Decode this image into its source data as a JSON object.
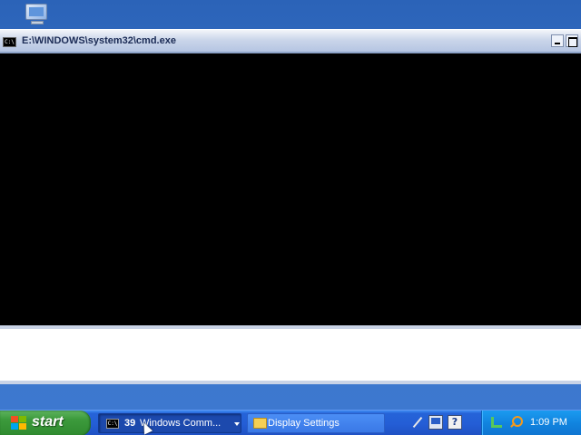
{
  "window": {
    "title": "E:\\WINDOWS\\system32\\cmd.exe",
    "icon_text": "C:\\"
  },
  "taskbar": {
    "start_label": "start",
    "tasks": [
      {
        "icon": "cmd-icon",
        "icon_text": "C:\\",
        "count": "39",
        "label": "Windows Comm..."
      },
      {
        "icon": "folder-icon",
        "label": "Display Settings"
      }
    ],
    "quick_launch": [
      "wand-icon",
      "monitor-icon",
      "help-icon"
    ],
    "help_glyph": "?",
    "tray_icons": [
      "network-icon",
      "search-icon"
    ],
    "clock": "1:09 PM"
  },
  "colors": {
    "desktop": "#3a73c9",
    "taskbar": "#245ed6",
    "start_button": "#3c9a3c",
    "console_bg": "#000000",
    "tray": "#1184df"
  }
}
